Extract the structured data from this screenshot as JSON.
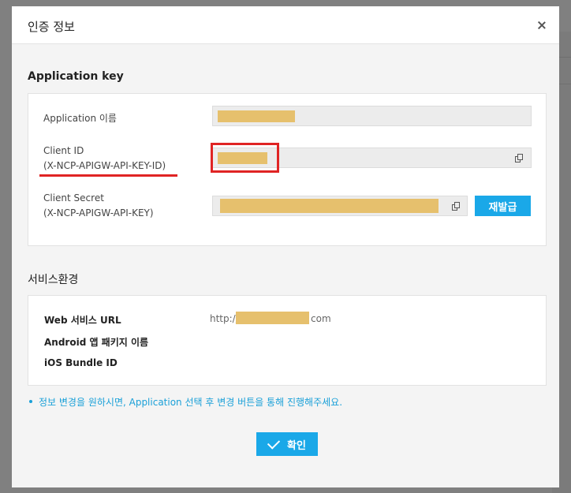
{
  "modal": {
    "title": "인증 정보",
    "close_label": "×"
  },
  "application_key": {
    "section_title": "Application key",
    "app_name_label": "Application 이름",
    "client_id_label_line1": "Client ID",
    "client_id_label_line2": "(X-NCP-APIGW-API-KEY-ID)",
    "client_secret_label_line1": "Client Secret",
    "client_secret_label_line2": "(X-NCP-APIGW-API-KEY)",
    "reissue_button": "재발급"
  },
  "service_env": {
    "section_title": "서비스환경",
    "web_url_label": "Web 서비스 URL",
    "web_url_prefix": "http://",
    "web_url_suffix": "com",
    "android_label": "Android 앱 패키지 이름",
    "ios_label": "iOS Bundle ID"
  },
  "notice": "정보 변경을 원하시면, Application 선택 후 변경 버튼을 통해 진행해주세요.",
  "confirm_button": "확인",
  "colors": {
    "accent": "#1aa8e8",
    "redaction": "#e6c06d",
    "annotation": "#e02424"
  }
}
